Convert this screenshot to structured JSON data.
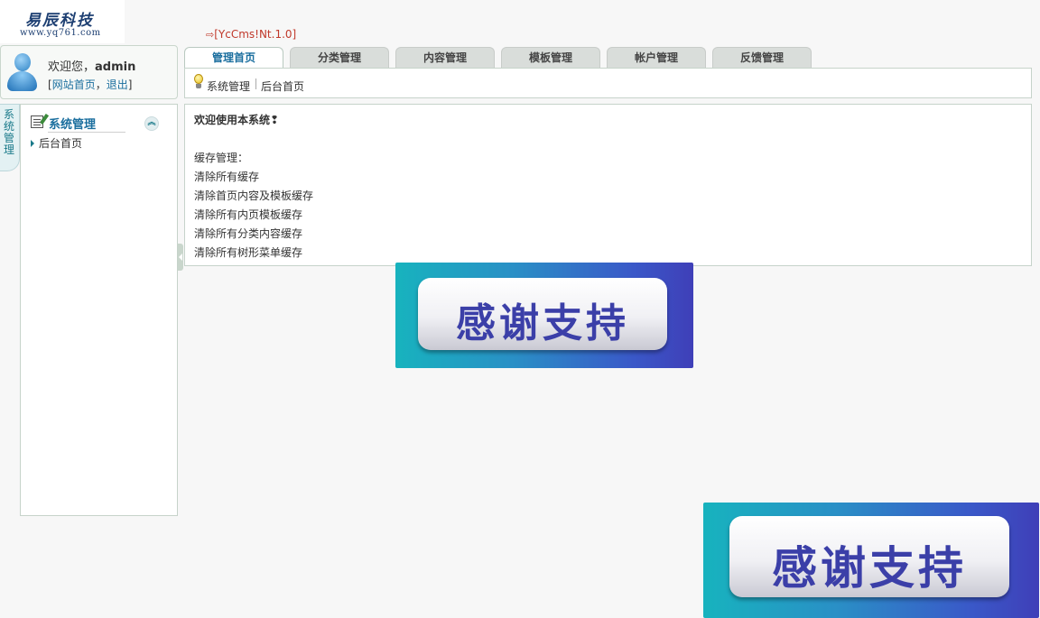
{
  "logo": {
    "name_cn": "易辰科技",
    "url": "www.yq761.com"
  },
  "version": "[YcCms!Nt.1.0]",
  "user": {
    "welcome_prefix": "欢迎您，",
    "username": "admin",
    "link_site": "网站首页",
    "link_logout": "退出"
  },
  "tabs": [
    {
      "label": "管理首页"
    },
    {
      "label": "分类管理"
    },
    {
      "label": "内容管理"
    },
    {
      "label": "模板管理"
    },
    {
      "label": "帐户管理"
    },
    {
      "label": "反馈管理"
    }
  ],
  "breadcrumb": {
    "section": "系统管理",
    "page": "后台首页"
  },
  "sidetab": {
    "label": "系统管理"
  },
  "menu": {
    "title": "系统管理",
    "items": [
      {
        "label": "后台首页"
      }
    ]
  },
  "content": {
    "title": "欢迎使用本系统❢",
    "cache_label": "缓存管理：",
    "cache_links": [
      {
        "label": "清除所有缓存"
      },
      {
        "label": "清除首页内容及模板缓存"
      },
      {
        "label": "清除所有内页模板缓存"
      },
      {
        "label": "清除所有分类内容缓存"
      },
      {
        "label": "清除所有树形菜单缓存"
      }
    ]
  },
  "banners": [
    {
      "text": "感谢支持"
    },
    {
      "text": "感谢支持"
    }
  ],
  "colors": {
    "accent": "#1a6e9e",
    "version": "#c0392b",
    "border": "#c6d3ca",
    "tab_bg": "#d9ddda"
  }
}
